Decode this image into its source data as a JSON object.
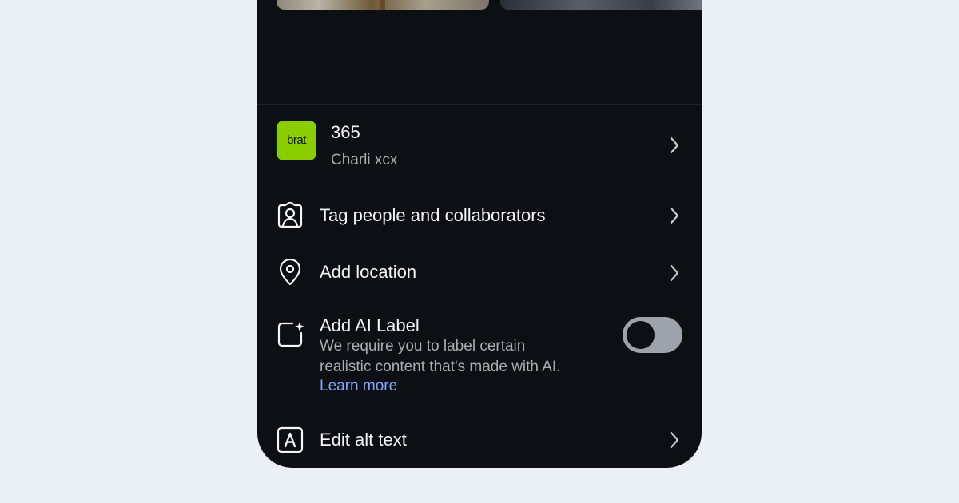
{
  "music": {
    "art_text": "brat",
    "song_title": "365",
    "artist": "Charli xcx",
    "art_color": "#8ace00"
  },
  "options": {
    "tag_label": "Tag people and collaborators",
    "location_label": "Add location",
    "ai_label_title": "Add AI Label",
    "ai_label_desc_1": "We require you to label certain",
    "ai_label_desc_2": "realistic content that's made with AI.",
    "learn_more": "Learn more",
    "ai_label_enabled": false,
    "alt_text_label": "Edit alt text"
  },
  "icons": {
    "tag": "tag-people-icon",
    "location": "location-pin-icon",
    "ai": "ai-label-icon",
    "alt": "alt-text-icon",
    "chevron": "chevron-right-icon"
  },
  "colors": {
    "background": "#0c1014",
    "link": "#80a8ff",
    "toggle_off": "#9ea3ab"
  }
}
